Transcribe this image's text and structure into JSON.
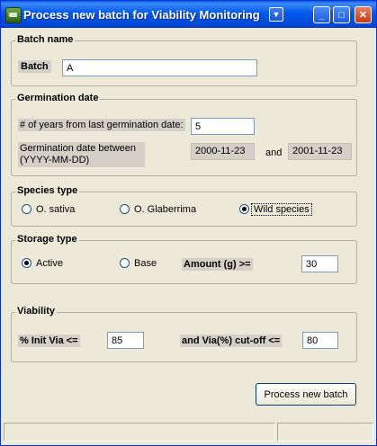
{
  "window": {
    "title": "Process new batch for Viability Monitoring",
    "menu_glyph": "▼",
    "minimize_glyph": "_",
    "maximize_glyph": "□",
    "close_glyph": "✕"
  },
  "batch": {
    "legend": "Batch name",
    "label": "Batch",
    "value": "A"
  },
  "germination": {
    "legend": "Germination date",
    "years_label": "# of years from last germination date:",
    "years_value": "5",
    "between_label_line1": "Germination date between",
    "between_label_line2": "(YYYY-MM-DD)",
    "date_from": "2000-11-23",
    "and_label": "and",
    "date_to": "2001-11-23"
  },
  "species": {
    "legend": "Species type",
    "options": [
      "O. sativa",
      "O. Glaberrima",
      "Wild species"
    ],
    "selected": "Wild species"
  },
  "storage": {
    "legend": "Storage type",
    "options": [
      "Active",
      "Base"
    ],
    "selected": "Active",
    "amount_label": "Amount (g) >=",
    "amount_value": "30"
  },
  "viability": {
    "legend": "Viability",
    "init_label": "% Init Via <=",
    "init_value": "85",
    "cutoff_label": "and  Via(%) cut-off <=",
    "cutoff_value": "80"
  },
  "actions": {
    "process_label": "Process new batch"
  },
  "colors": {
    "titlebar": "#0058ee",
    "window_bg": "#ece9d8",
    "label_shade": "#d4d0c8"
  }
}
